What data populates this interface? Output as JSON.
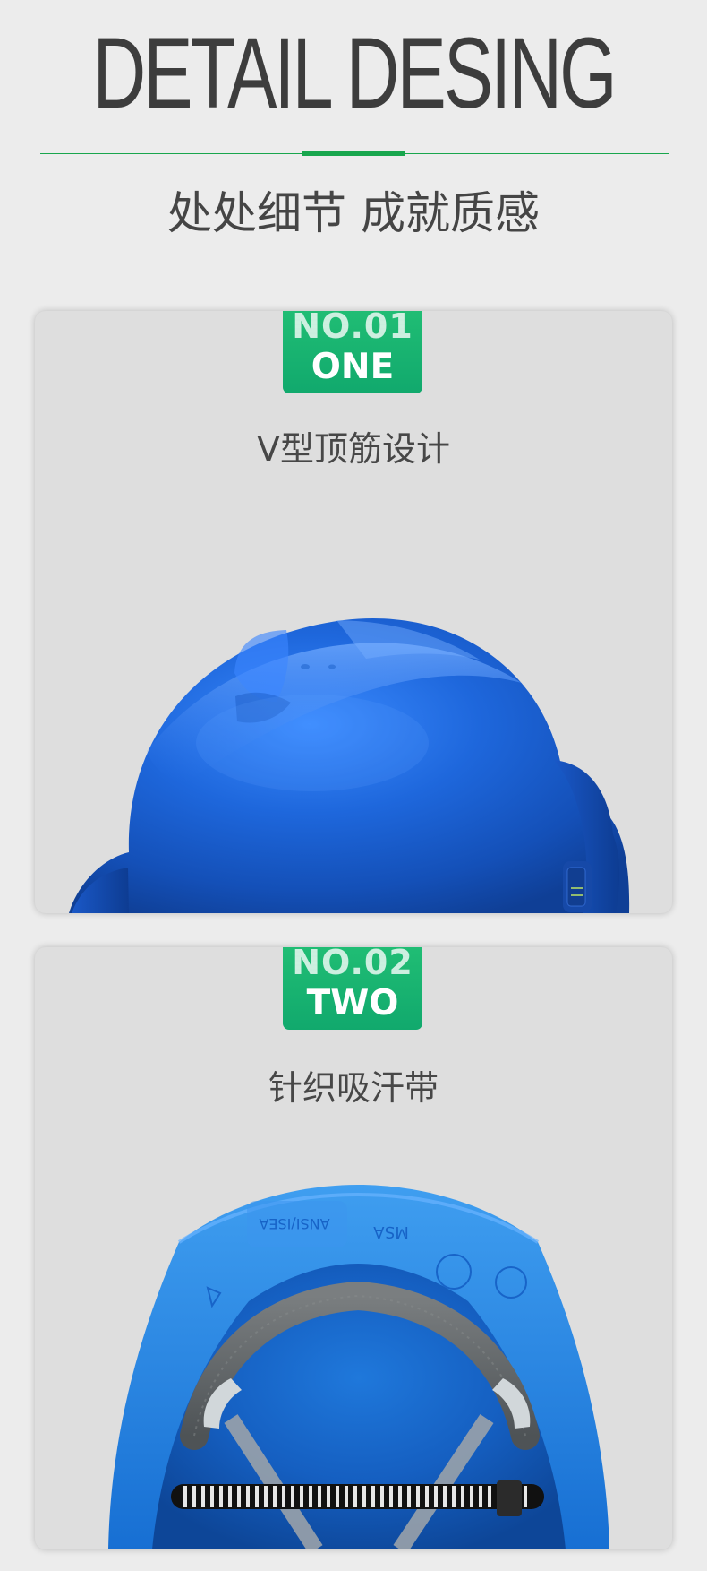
{
  "header": {
    "title": "DETAIL DESING",
    "subtitle": "处处细节 成就质感"
  },
  "sections": [
    {
      "number": "NO.01",
      "word": "ONE",
      "label": "V型顶筋设计"
    },
    {
      "number": "NO.02",
      "word": "TWO",
      "label": "针织吸汗带"
    }
  ],
  "colors": {
    "accent_green": "#18a64d",
    "badge_green": "#14aa6d",
    "helmet_blue": "#1d63d6",
    "card_gray": "#dedede",
    "page_bg": "#ececec"
  },
  "images": {
    "top_view": "blue-hard-hat-exterior",
    "inside_view": "blue-hard-hat-interior"
  }
}
